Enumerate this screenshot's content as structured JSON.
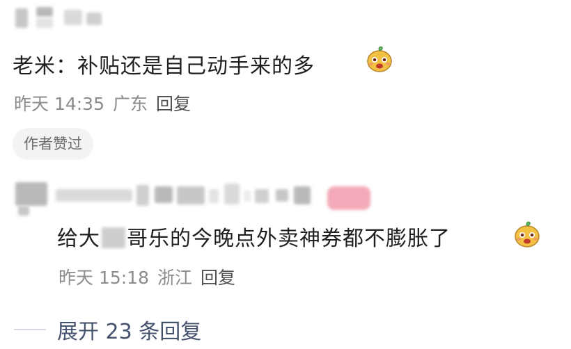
{
  "comment1": {
    "text": "老米：补贴还是自己动手来的多",
    "time": "昨天 14:35",
    "location": "广东",
    "reply_label": "回复",
    "badge": "作者赞过"
  },
  "comment2": {
    "text_before": "给大",
    "text_after": "哥乐的今晚点外卖神券都不膨胀了",
    "time": "昨天 15:18",
    "location": "浙江",
    "reply_label": "回复"
  },
  "expand_replies": "展开 23 条回复",
  "icons": {
    "emoji": "smiling-sprout-face-emoji"
  }
}
